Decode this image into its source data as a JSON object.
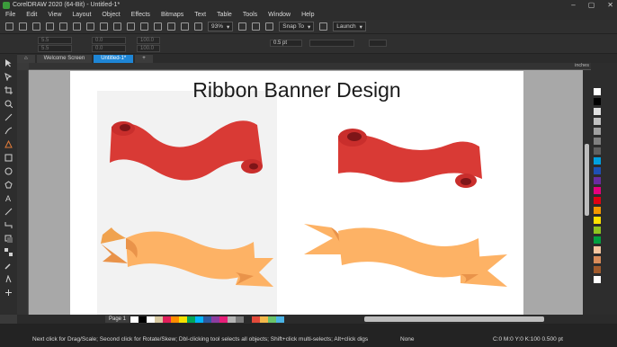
{
  "window": {
    "title": "CorelDRAW 2020 (64-Bit) - Untitled-1*",
    "controls": [
      "–",
      "▢",
      "✕"
    ]
  },
  "menu": [
    "File",
    "Edit",
    "View",
    "Layout",
    "Object",
    "Effects",
    "Bitmaps",
    "Text",
    "Table",
    "Tools",
    "Window",
    "Help"
  ],
  "toolbar": {
    "zoom": "93%",
    "snap_to": "Snap To",
    "launch": "Launch"
  },
  "properties": {
    "x": "5.5",
    "y": "5.5",
    "w": "0.0",
    "h": "0.0",
    "scale_x": "100.0",
    "scale_y": "100.0",
    "outline_width": "0.5 pt"
  },
  "doc_tabs": [
    {
      "label": "Welcome Screen",
      "active": false
    },
    {
      "label": "Untitled-1*",
      "active": true
    }
  ],
  "ruler_unit": "inches",
  "page_heading": "Ribbon Banner Design",
  "page_tab": "Page 1",
  "status": {
    "hint": "Next click for Drag/Scale; Second click for Rotate/Skew; Dbl-clicking tool selects all objects; Shift+click multi-selects; Alt+click digs",
    "fill": "None",
    "outline": "C:0 M:0 Y:0 K:100  0.500 pt"
  },
  "palette_colors": [
    "#ffffff",
    "#000000",
    "#e0e0e0",
    "#c0c0c0",
    "#a0a0a0",
    "#808080",
    "#606060",
    "#00a0e0",
    "#1e50b4",
    "#6a2ca0",
    "#e6007e",
    "#e10014",
    "#f39800",
    "#ffe100",
    "#8fc31f",
    "#00a040",
    "#f5c6a0",
    "#d98c5a",
    "#a05a2c",
    "#ffffff"
  ],
  "doc_palette_colors": [
    "#ffffff",
    "#000000",
    "#ffffff",
    "#d6c8a0",
    "#e01e5a",
    "#ff8c00",
    "#f5e100",
    "#00a65a",
    "#00b4ff",
    "#2d5aa0",
    "#8c3ca0",
    "#e61e78",
    "#b4b4b4",
    "#7a7a7a",
    "#2a2a2a",
    "#e34a3a",
    "#f3b84a",
    "#6ac46a",
    "#4ab4e6"
  ],
  "colors": {
    "red_ribbon": "#d93a35",
    "red_ribbon_dark": "#a81e22",
    "orange_ribbon": "#fdb265",
    "orange_ribbon_dark": "#e9934a",
    "accent": "#1e86d6"
  }
}
